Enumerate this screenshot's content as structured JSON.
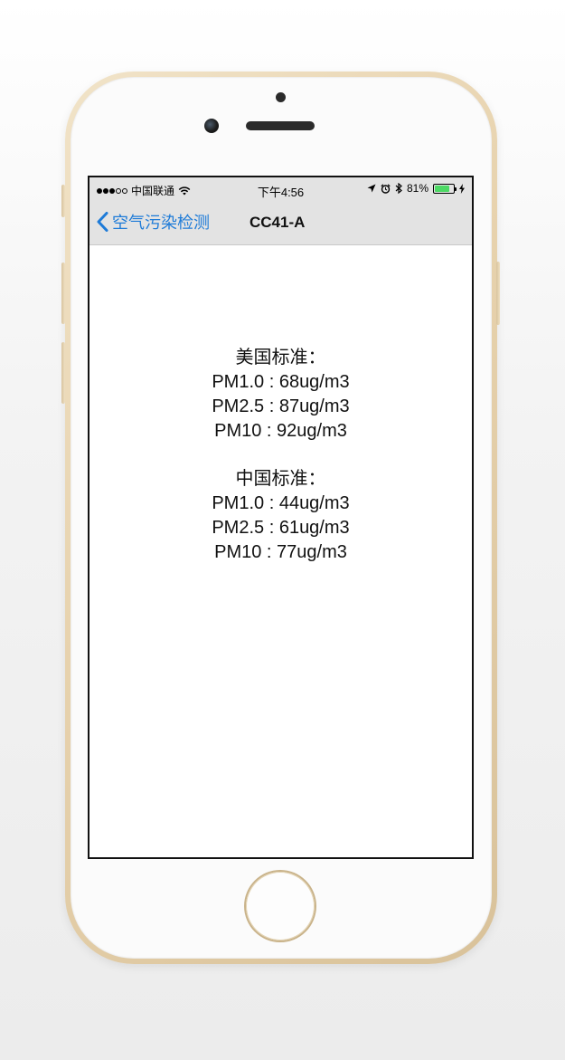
{
  "status_bar": {
    "carrier": "中国联通",
    "time": "下午4:56",
    "battery": "81%",
    "battery_level": 0.81,
    "battery_color": "#4cd964"
  },
  "nav": {
    "back_label": "空气污染检测",
    "title": "CC41-A",
    "accent_color": "#1e7bd8"
  },
  "readings": {
    "us": {
      "heading": "美国标准：",
      "lines": [
        "PM1.0 : 68ug/m3",
        "PM2.5 : 87ug/m3",
        "PM10 : 92ug/m3"
      ]
    },
    "cn": {
      "heading": "中国标准：",
      "lines": [
        "PM1.0 : 44ug/m3",
        "PM2.5 : 61ug/m3",
        "PM10 : 77ug/m3"
      ]
    }
  },
  "icons": {
    "back": "chevron-left-icon",
    "wifi": "wifi-icon",
    "location": "location-arrow-icon",
    "alarm": "alarm-icon",
    "bluetooth": "bluetooth-icon",
    "charging": "charging-bolt-icon"
  }
}
